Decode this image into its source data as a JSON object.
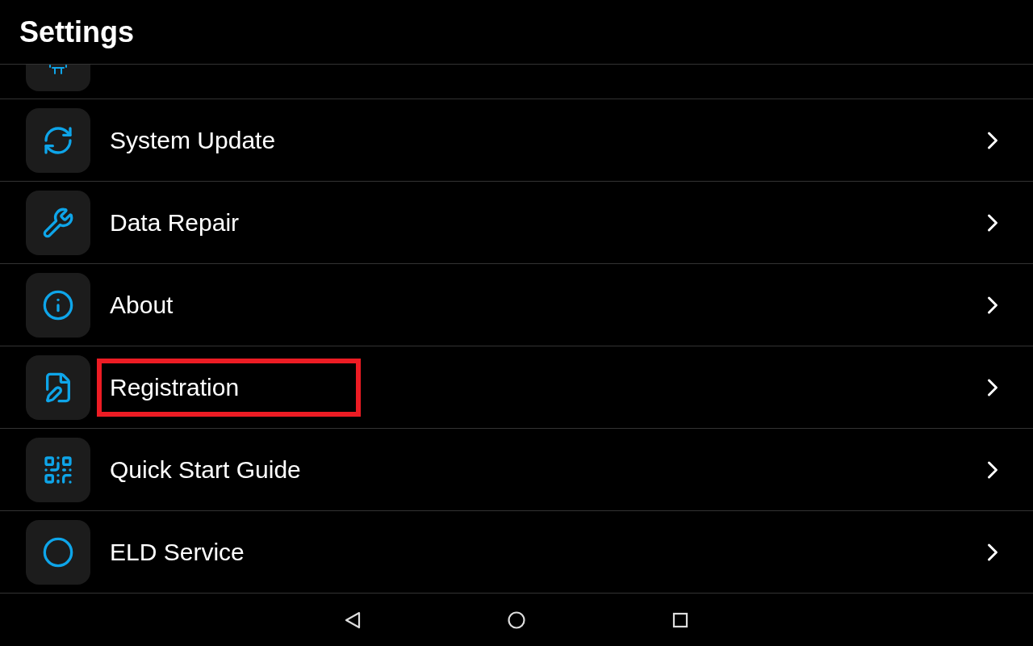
{
  "title": "Settings",
  "items": [
    {
      "label": "System Update",
      "highlighted": false
    },
    {
      "label": "Data Repair",
      "highlighted": false
    },
    {
      "label": "About",
      "highlighted": false
    },
    {
      "label": "Registration",
      "highlighted": true
    },
    {
      "label": "Quick Start Guide",
      "highlighted": false
    },
    {
      "label": "ELD Service",
      "highlighted": false
    }
  ]
}
